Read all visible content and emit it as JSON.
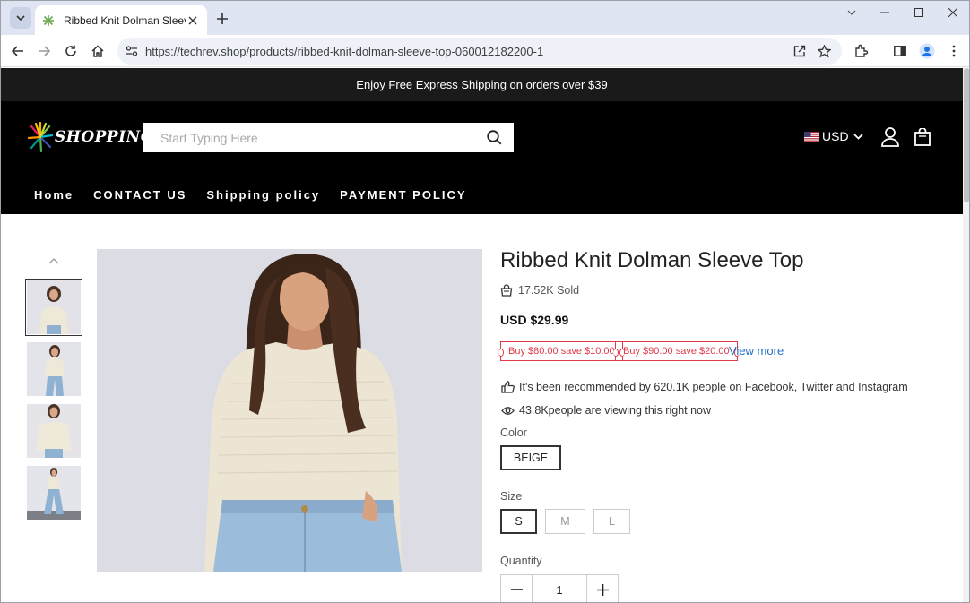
{
  "browser": {
    "tab": {
      "title": "Ribbed Knit Dolman Sleeve Top"
    },
    "url": "https://techrev.shop/products/ribbed-knit-dolman-sleeve-top-060012182200-1"
  },
  "store": {
    "promo": "Enjoy Free Express Shipping on orders over $39",
    "logo_text": "SHOPPING",
    "search": {
      "placeholder": "Start Typing Here"
    },
    "currency": "USD",
    "nav": [
      "Home",
      "CONTACT US",
      "Shipping policy",
      "PAYMENT POLICY"
    ]
  },
  "product": {
    "title": "Ribbed Knit Dolman Sleeve Top",
    "sold": "17.52K Sold",
    "price": "USD $29.99",
    "coupons": [
      "Buy $80.00 save $10.00",
      "Buy $90.00 save $20.00"
    ],
    "view_more": "View more",
    "recommended": "It's been recommended by 620.1K people on Facebook, Twitter and Instagram",
    "viewing": "43.8Kpeople are viewing this right now",
    "color_label": "Color",
    "colors": [
      "BEIGE"
    ],
    "selected_color": "BEIGE",
    "size_label": "Size",
    "sizes": [
      "S",
      "M",
      "L"
    ],
    "selected_size": "S",
    "quantity_label": "Quantity",
    "quantity": "1"
  },
  "colors": {
    "accent_link": "#2271c9",
    "coupon_red": "#e03a4a",
    "header_bg": "#000000",
    "promo_bg": "#1a1a1a"
  }
}
